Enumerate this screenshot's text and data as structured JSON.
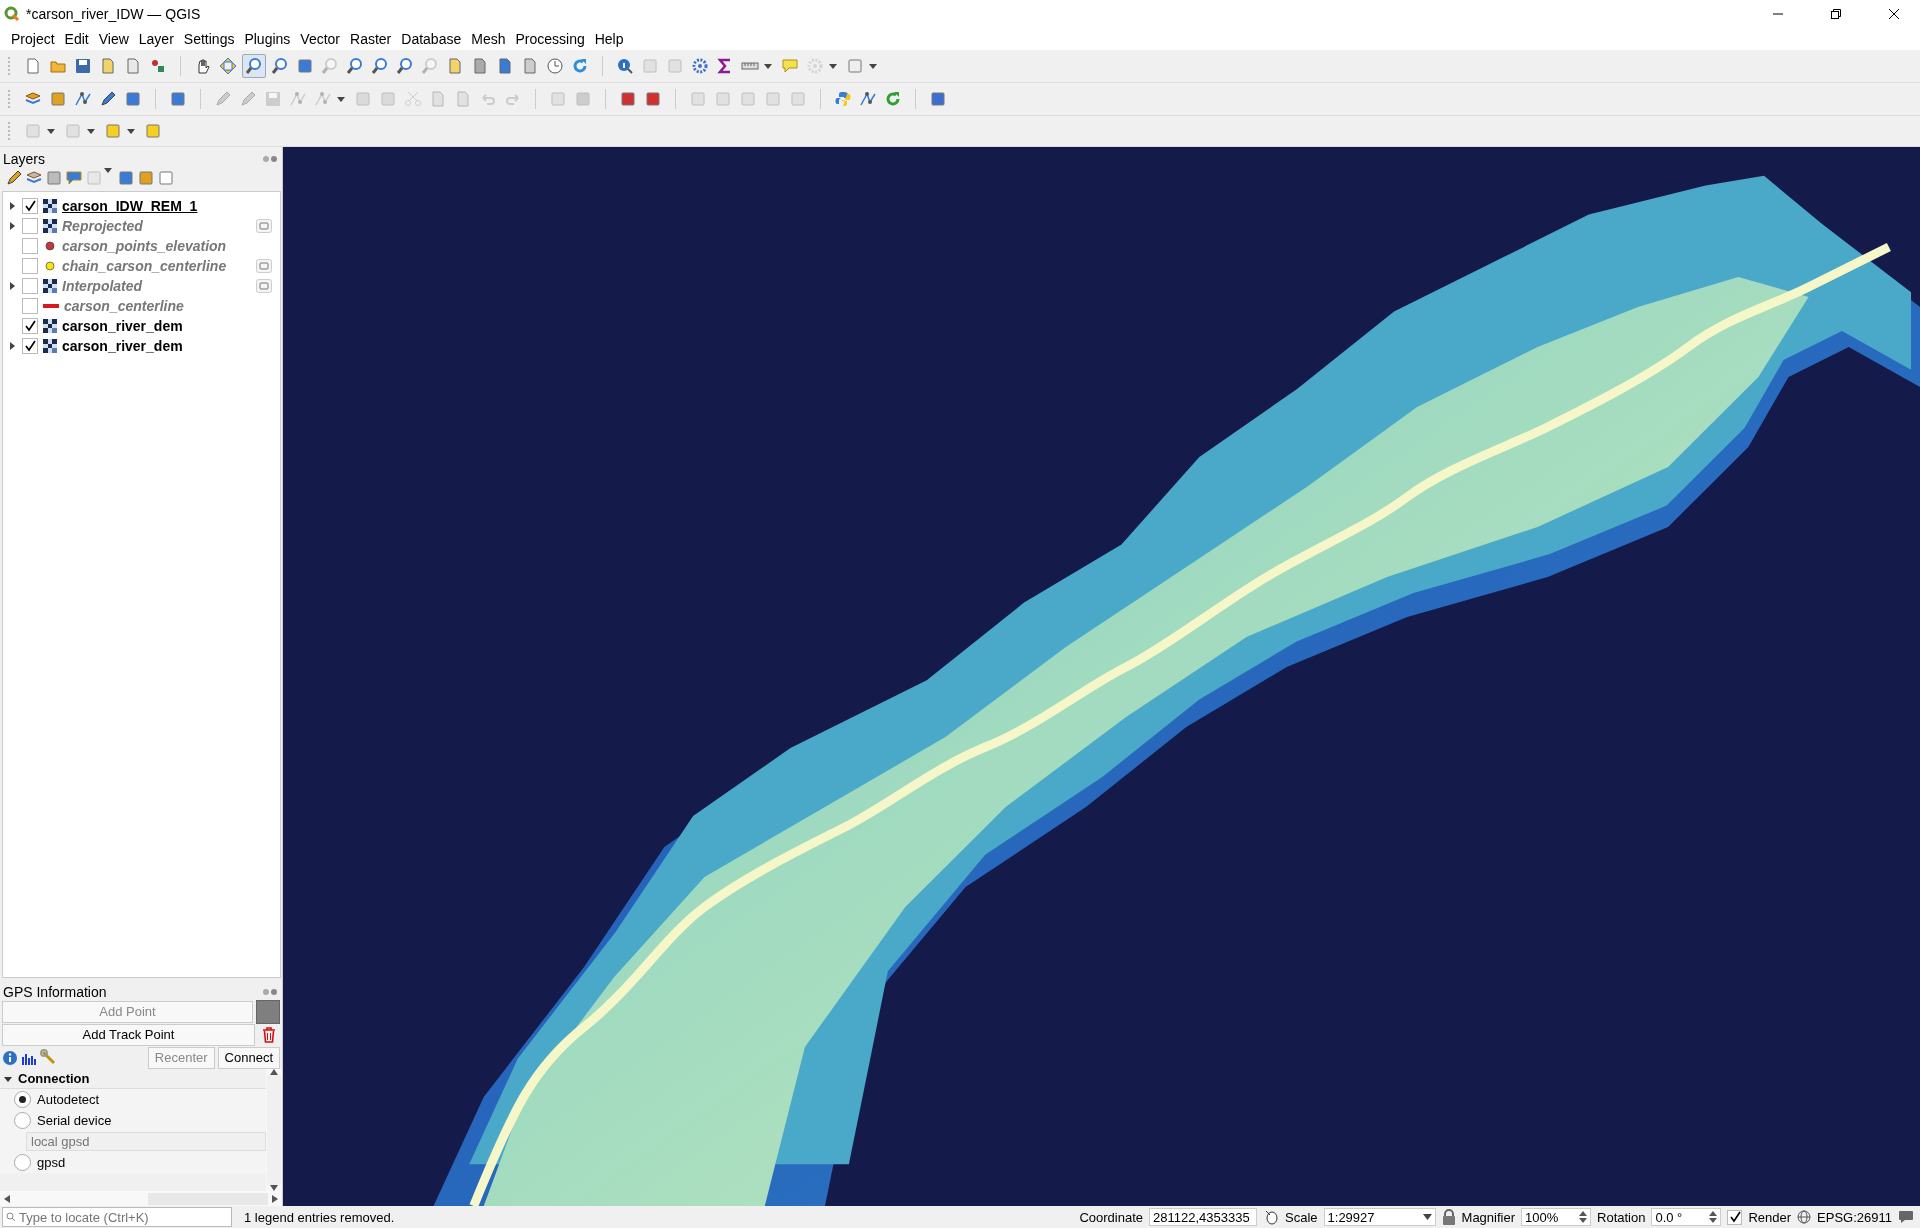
{
  "window": {
    "title": "*carson_river_IDW — QGIS"
  },
  "menu": [
    "Project",
    "Edit",
    "View",
    "Layer",
    "Settings",
    "Plugins",
    "Vector",
    "Raster",
    "Database",
    "Mesh",
    "Processing",
    "Help"
  ],
  "layers_panel": {
    "title": "Layers",
    "layers": [
      {
        "name": "carson_IDW_REM_1",
        "kind": "raster",
        "checked": true,
        "has_children": true,
        "selected": true,
        "embedded": false
      },
      {
        "name": "Reprojected",
        "kind": "raster",
        "checked": false,
        "has_children": true,
        "selected": false,
        "embedded": true
      },
      {
        "name": "carson_points_elevation",
        "kind": "point",
        "color": "#c0393b",
        "checked": false,
        "has_children": false,
        "selected": false,
        "embedded": false
      },
      {
        "name": "chain_carson_centerline",
        "kind": "point",
        "color": "#f5e50a",
        "checked": false,
        "has_children": false,
        "selected": false,
        "embedded": true
      },
      {
        "name": "Interpolated",
        "kind": "raster",
        "checked": false,
        "has_children": true,
        "selected": false,
        "embedded": true
      },
      {
        "name": "carson_centerline",
        "kind": "line",
        "color": "#d7191c",
        "checked": false,
        "has_children": false,
        "selected": false,
        "embedded": false
      },
      {
        "name": "carson_river_dem",
        "kind": "raster",
        "checked": true,
        "has_children": false,
        "selected": false,
        "embedded": false
      },
      {
        "name": "carson_river_dem",
        "kind": "raster",
        "checked": true,
        "has_children": true,
        "selected": false,
        "embedded": false
      }
    ]
  },
  "gps_panel": {
    "title": "GPS Information",
    "add_point": {
      "label": "Add Point",
      "disabled": true
    },
    "add_track_point": {
      "label": "Add Track Point",
      "disabled": false
    },
    "recenter": {
      "label": "Recenter",
      "disabled": true
    },
    "connect": {
      "label": "Connect",
      "disabled": false
    },
    "section": {
      "label": "Connection",
      "expanded": true
    },
    "options": [
      {
        "label": "Autodetect",
        "selected": true
      },
      {
        "label": "Serial device",
        "selected": false
      }
    ],
    "host_field": {
      "placeholder": "local gpsd"
    },
    "gpsd_option": {
      "label": "gpsd",
      "selected": false
    }
  },
  "status_bar": {
    "locator": {
      "placeholder": "Type to locate (Ctrl+K)"
    },
    "message": "1 legend entries removed.",
    "coordinate_label": "Coordinate",
    "coordinate": "281122,4353335",
    "scale_label": "Scale",
    "scale": "1:29927",
    "magnifier_label": "Magnifier",
    "magnifier": "100%",
    "rotation_label": "Rotation",
    "rotation": "0.0 °",
    "render": {
      "label": "Render",
      "checked": true
    },
    "crs": "EPSG:26911"
  }
}
